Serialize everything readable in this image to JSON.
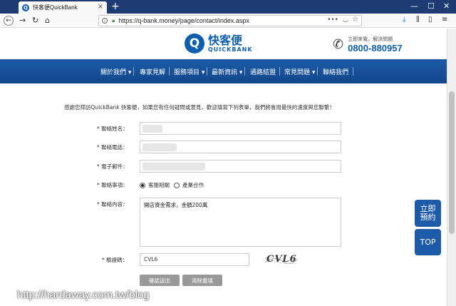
{
  "browser": {
    "tab_title": "快客便QuickBank",
    "tab_fav": "Q",
    "url": "https://q-bank.money/page/contact/index.aspx"
  },
  "header": {
    "logo_mark": "Q",
    "logo_cn": "快客便",
    "logo_en": "QUICKBANK",
    "hotline_label": "立即來電，解決問題",
    "hotline_number": "0800-880957"
  },
  "menu": {
    "items": [
      "關於我們 ▾",
      "專家見解",
      "服務項目 ▾",
      "最新資訊 ▾",
      "通路結盟",
      "常見問題 ▾",
      "聯絡我們"
    ]
  },
  "form": {
    "intro": "感謝您拜訪QuickBank 快客便，如果您有任何疑問或意見，歡迎填寫下列表單，我們將會用最快的速度與您聯繫！",
    "name_label": "* 聯絡姓名：",
    "phone_label": "* 聯絡電話：",
    "email_label": "* 電子郵件：",
    "topic_label": "* 聯絡事項：",
    "topic_options": [
      "客服相關",
      "產業合作"
    ],
    "content_label": "* 聯絡內容：",
    "content_value": "開店資金需求，金額200萬",
    "captcha_label": "* 驗證碼：",
    "captcha_value": "CVL6",
    "captcha_image_text": "CVL6",
    "submit_label": "確認送出",
    "reset_label": "清除重填"
  },
  "side": {
    "reserve_label": "立即預約",
    "top_label": "TOP"
  },
  "watermark": "http://hardaway.com.tw/blog"
}
